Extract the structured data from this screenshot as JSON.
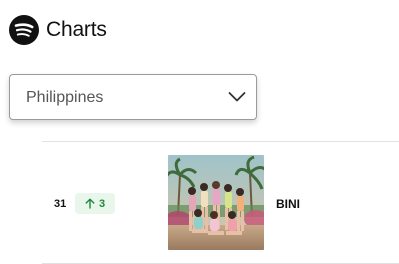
{
  "header": {
    "title": "Charts"
  },
  "region_select": {
    "value": "Philippines"
  },
  "chart_rows": [
    {
      "rank": "31",
      "change": "3",
      "change_direction": "up",
      "artist": "BINI",
      "artwork_icon": "group-photo"
    }
  ],
  "colors": {
    "logo": "#111111",
    "change_up_text": "#1d8a3e",
    "change_up_bg": "#e8f6ec",
    "divider": "#e2e2e2"
  }
}
